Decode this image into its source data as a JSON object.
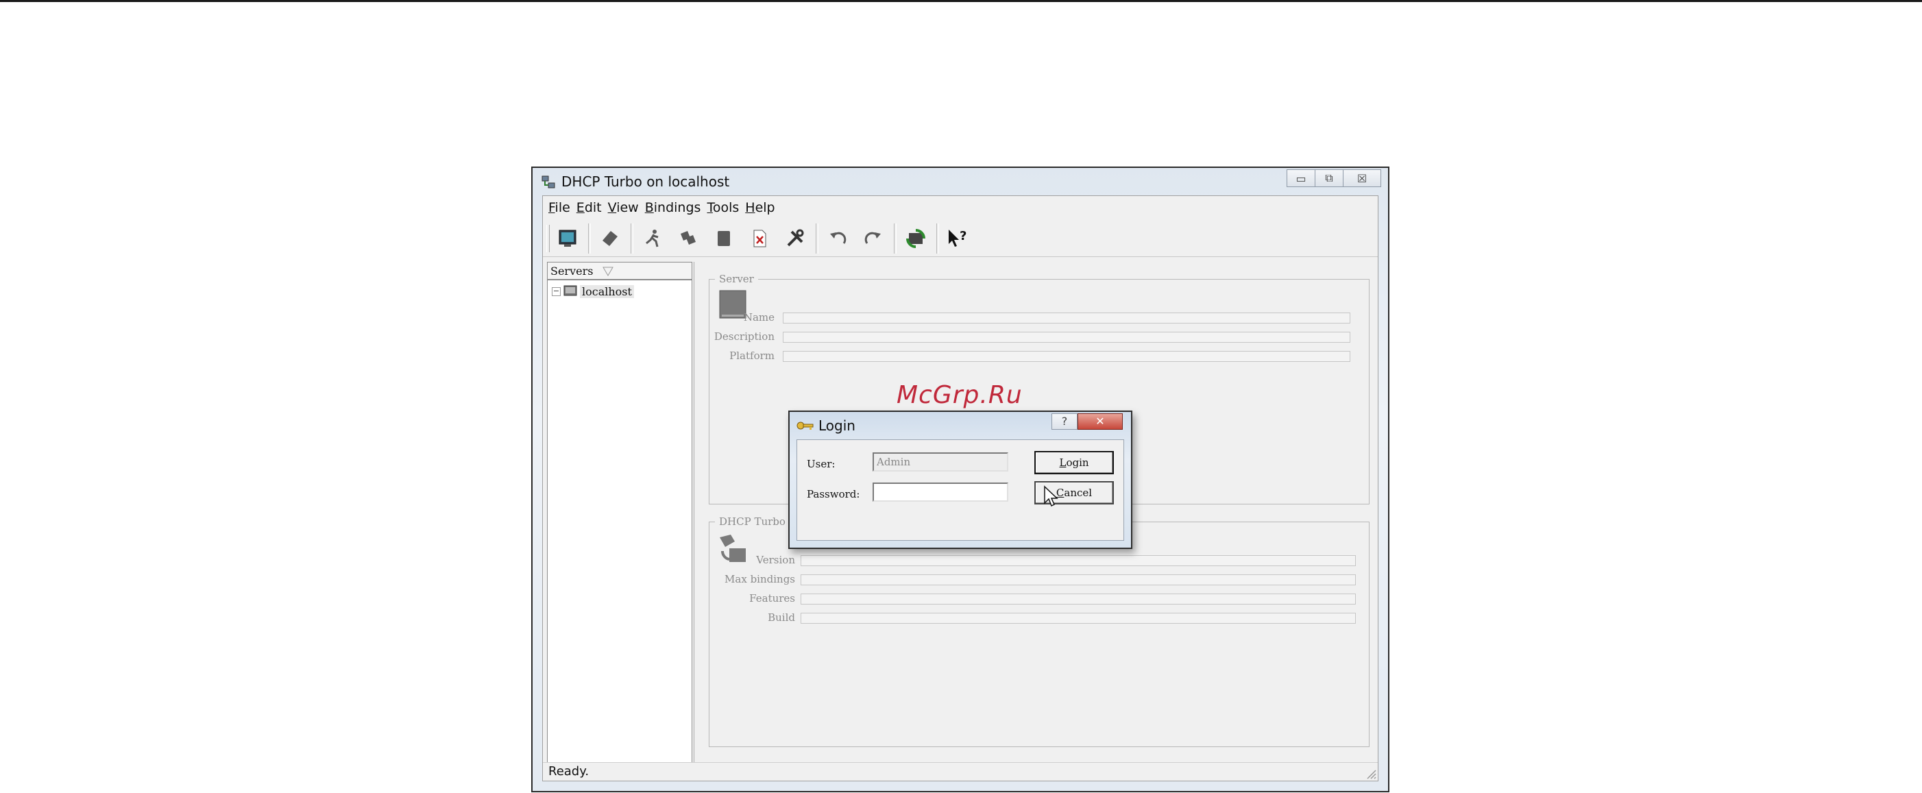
{
  "window": {
    "title": "DHCP Turbo on localhost",
    "caption_minimize": "▭",
    "caption_restore": "⧉",
    "caption_close": "☒"
  },
  "menu": {
    "items": [
      {
        "mnemonic": "F",
        "rest": "ile"
      },
      {
        "mnemonic": "E",
        "rest": "dit"
      },
      {
        "mnemonic": "V",
        "rest": "iew"
      },
      {
        "mnemonic": "B",
        "rest": "indings"
      },
      {
        "mnemonic": "T",
        "rest": "ools"
      },
      {
        "mnemonic": "H",
        "rest": "elp"
      }
    ]
  },
  "toolbar": {
    "icons": [
      "monitor-icon",
      "eraser-icon",
      "run-icon",
      "copy-icon",
      "paste-icon",
      "delete-doc-icon",
      "tools-icon",
      "undo-icon",
      "redo-icon",
      "refresh-icon",
      "context-help-icon"
    ]
  },
  "tree": {
    "header": "Servers",
    "expander": "−",
    "node_label": "localhost"
  },
  "server_group": {
    "legend": "Server",
    "name_label": "Name",
    "description_label": "Description",
    "platform_label": "Platform"
  },
  "dhcp_group": {
    "legend": "DHCP Turbo",
    "version_label": "Version",
    "max_bindings_label": "Max bindings",
    "features_label": "Features",
    "build_label": "Build"
  },
  "status": {
    "text": "Ready."
  },
  "watermark": "McGrp.Ru",
  "login": {
    "title": "Login",
    "help": "?",
    "close": "✕",
    "user_label": "User:",
    "user_value": "Admin",
    "password_label": "Password:",
    "password_value": "",
    "login_mnemonic": "L",
    "login_rest": "ogin",
    "cancel_mnemonic": "C",
    "cancel_rest": "ancel"
  },
  "colors": {
    "watermark": "#c0283a",
    "titlebar": "#dfe7f0",
    "close_button": "#c8473a"
  }
}
